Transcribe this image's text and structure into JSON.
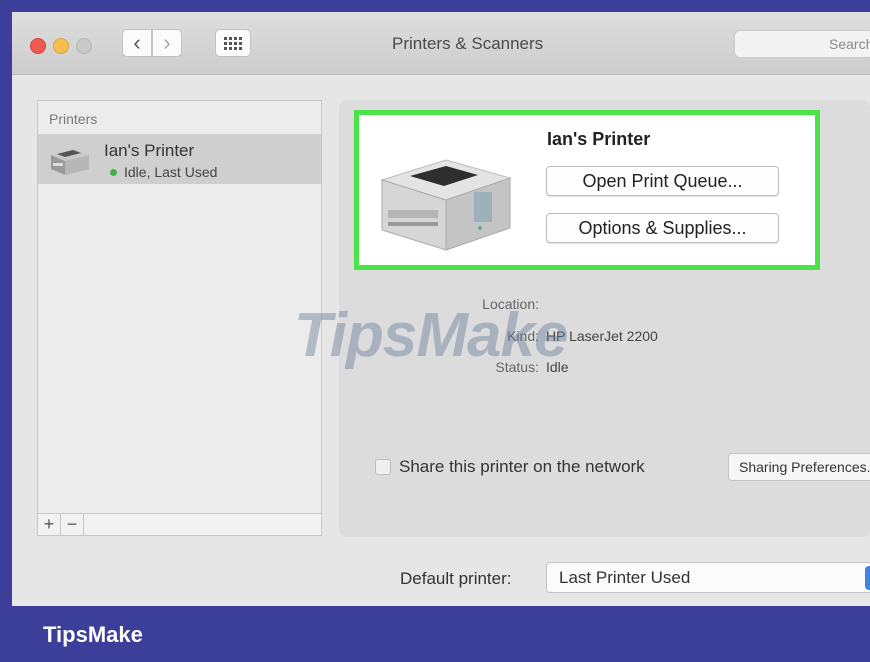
{
  "window": {
    "title": "Printers & Scanners",
    "search_placeholder": "Search"
  },
  "sidebar": {
    "header": "Printers",
    "printers": [
      {
        "name": "Ian's Printer",
        "status": "Idle, Last Used",
        "status_color": "#3db248"
      }
    ],
    "add_symbol": "+",
    "remove_symbol": "−"
  },
  "detail": {
    "printer_name": "Ian's Printer",
    "open_queue_label": "Open Print Queue...",
    "options_label": "Options & Supplies...",
    "location_label": "Location:",
    "location_value": "",
    "kind_label": "Kind:",
    "kind_value": "HP LaserJet 2200",
    "status_label": "Status:",
    "status_value": "Idle",
    "highlight_color": "#4ce34a"
  },
  "sharing": {
    "checkbox_label": "Share this printer on the network",
    "checked": false,
    "preferences_label": "Sharing Preferences..."
  },
  "default_printer": {
    "label": "Default printer:",
    "value": "Last Printer Used"
  },
  "watermark": "TipsMake",
  "brand": {
    "name": "TipsMake",
    "bar_color": "#3b3f9a"
  }
}
